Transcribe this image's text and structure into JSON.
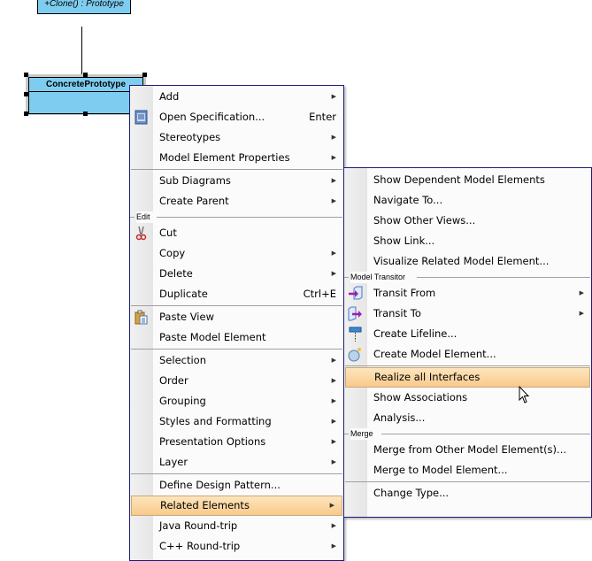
{
  "diagram": {
    "parent_class_operation": "+Clone() : Prototype",
    "selected_class_name": "ConcretePrototype",
    "class_fill_color": "#7ecdf0"
  },
  "context_menu": {
    "items": [
      {
        "label": "Add",
        "submenu": true
      },
      {
        "label": "Open Specification...",
        "shortcut": "Enter",
        "icon": "specification-icon"
      },
      {
        "label": "Stereotypes",
        "submenu": true
      },
      {
        "label": "Model Element Properties",
        "submenu": true
      },
      {
        "label": "Sub Diagrams",
        "submenu": true
      },
      {
        "label": "Create Parent",
        "submenu": true
      },
      {
        "label": "Cut",
        "icon": "scissors-icon"
      },
      {
        "label": "Copy",
        "submenu": true
      },
      {
        "label": "Delete",
        "submenu": true
      },
      {
        "label": "Duplicate",
        "shortcut": "Ctrl+E"
      },
      {
        "label": "Paste View",
        "icon": "clipboard-icon"
      },
      {
        "label": "Paste Model Element"
      },
      {
        "label": "Selection",
        "submenu": true
      },
      {
        "label": "Order",
        "submenu": true
      },
      {
        "label": "Grouping",
        "submenu": true
      },
      {
        "label": "Styles and Formatting",
        "submenu": true
      },
      {
        "label": "Presentation Options",
        "submenu": true
      },
      {
        "label": "Layer",
        "submenu": true
      },
      {
        "label": "Define Design Pattern..."
      },
      {
        "label": "Related Elements",
        "submenu": true,
        "highlighted": true
      },
      {
        "label": "Java Round-trip",
        "submenu": true
      },
      {
        "label": "C++ Round-trip",
        "submenu": true
      }
    ],
    "groups": {
      "edit": "Edit"
    }
  },
  "related_submenu": {
    "items": [
      {
        "label": "Show Dependent Model Elements"
      },
      {
        "label": "Navigate To..."
      },
      {
        "label": "Show Other Views..."
      },
      {
        "label": "Show Link..."
      },
      {
        "label": "Visualize Related Model Element..."
      },
      {
        "label": "Transit From",
        "submenu": true,
        "icon": "transit-from-icon"
      },
      {
        "label": "Transit To",
        "submenu": true,
        "icon": "transit-to-icon"
      },
      {
        "label": "Create Lifeline...",
        "icon": "lifeline-icon"
      },
      {
        "label": "Create Model Element...",
        "icon": "model-element-icon"
      },
      {
        "label": "Realize all Interfaces",
        "highlighted": true
      },
      {
        "label": "Show Associations"
      },
      {
        "label": "Analysis..."
      },
      {
        "label": "Merge from Other Model Element(s)..."
      },
      {
        "label": "Merge to Model Element..."
      },
      {
        "label": "Change Type..."
      }
    ],
    "groups": {
      "model_transitor": "Model Transitor",
      "merge": "Merge"
    }
  },
  "colors": {
    "highlight_top": "#fde5bd",
    "highlight_bottom": "#f9c98b",
    "menu_border": "#1c1c7a"
  }
}
